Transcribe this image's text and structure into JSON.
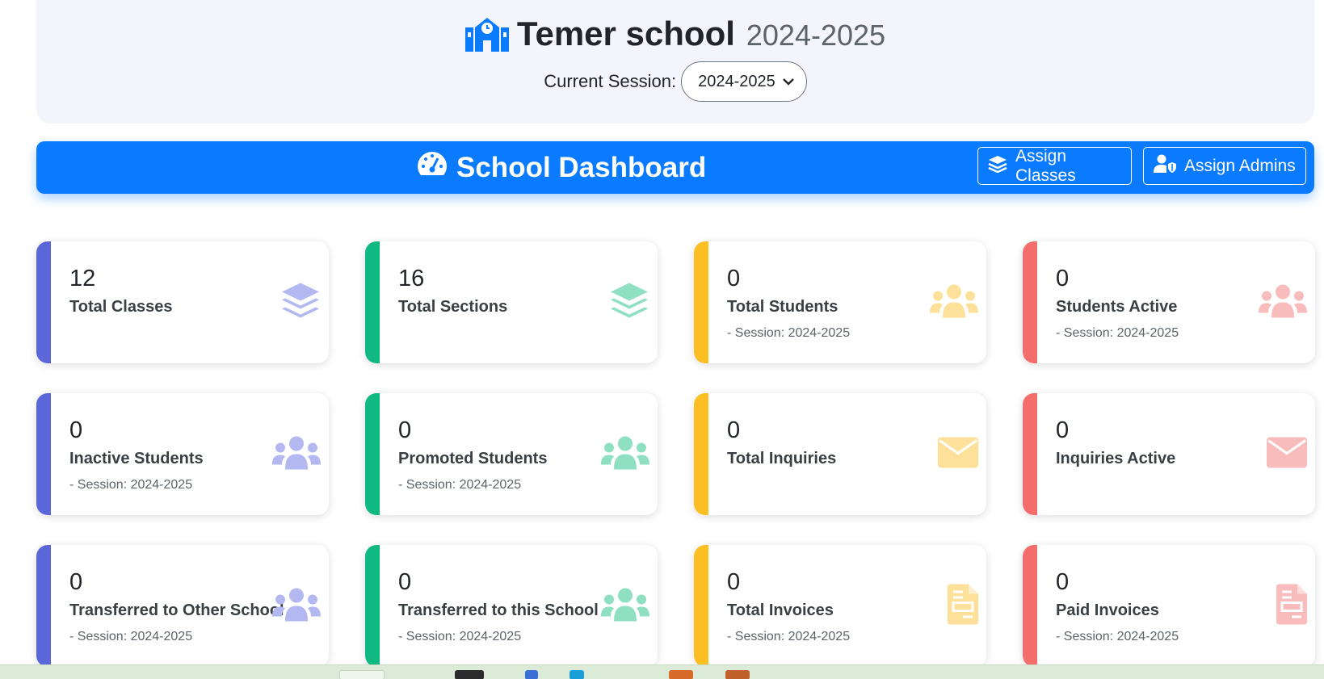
{
  "header": {
    "school_name": "Temer school",
    "year": "2024-2025",
    "session_label": "Current Session:",
    "session_value": "2024-2025"
  },
  "dashboard": {
    "title": "School Dashboard",
    "assign_classes_label": "Assign Classes",
    "assign_admins_label": "Assign Admins"
  },
  "colors": {
    "primary": "#0a7bff",
    "purple": "#5b67d8",
    "green": "#10b981",
    "yellow": "#fbbf24",
    "red": "#f36d6d",
    "header_bg": "#f4f5fc"
  },
  "cards": [
    {
      "value": "12",
      "label": "Total Classes",
      "sub": "",
      "color": "purple",
      "icon": "layers-icon"
    },
    {
      "value": "16",
      "label": "Total Sections",
      "sub": "",
      "color": "green",
      "icon": "layers-icon"
    },
    {
      "value": "0",
      "label": "Total Students",
      "sub": "- Session: 2024-2025",
      "color": "yellow",
      "icon": "users-icon"
    },
    {
      "value": "0",
      "label": "Students Active",
      "sub": "- Session: 2024-2025",
      "color": "red",
      "icon": "users-icon"
    },
    {
      "value": "0",
      "label": "Inactive Students",
      "sub": "- Session: 2024-2025",
      "color": "purple",
      "icon": "users-icon"
    },
    {
      "value": "0",
      "label": "Promoted Students",
      "sub": "- Session: 2024-2025",
      "color": "green",
      "icon": "users-icon"
    },
    {
      "value": "0",
      "label": "Total Inquiries",
      "sub": "",
      "color": "yellow",
      "icon": "envelope-icon"
    },
    {
      "value": "0",
      "label": "Inquiries Active",
      "sub": "",
      "color": "red",
      "icon": "envelope-icon"
    },
    {
      "value": "0",
      "label": "Transferred to Other School",
      "sub": "- Session: 2024-2025",
      "color": "purple",
      "icon": "users-icon"
    },
    {
      "value": "0",
      "label": "Transferred to this School",
      "sub": "- Session: 2024-2025",
      "color": "green",
      "icon": "users-icon"
    },
    {
      "value": "0",
      "label": "Total Invoices",
      "sub": "- Session: 2024-2025",
      "color": "yellow",
      "icon": "invoice-icon"
    },
    {
      "value": "0",
      "label": "Paid Invoices",
      "sub": "- Session: 2024-2025",
      "color": "red",
      "icon": "invoice-icon"
    }
  ]
}
